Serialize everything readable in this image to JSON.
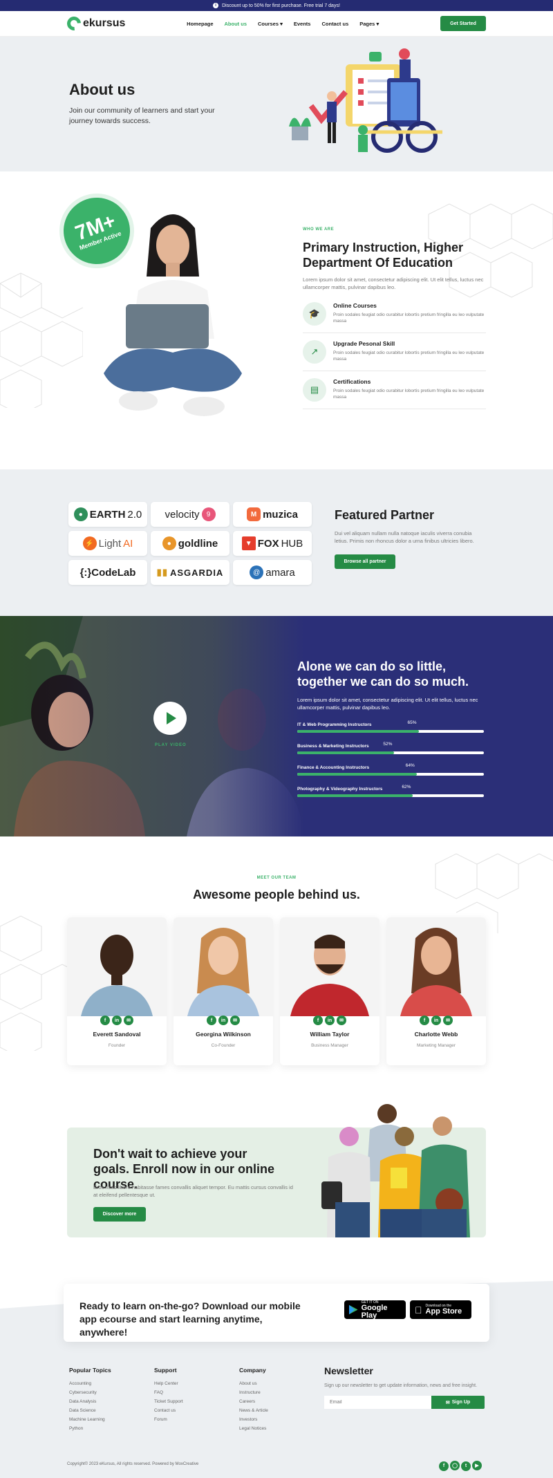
{
  "topbar": {
    "text": "Discount up to 50% for first purchase. Free trial 7 days!"
  },
  "nav": {
    "brand": "ekursus",
    "items": [
      "Homepage",
      "About us",
      "Courses",
      "Events",
      "Contact us",
      "Pages"
    ],
    "cta": "Get Started"
  },
  "hero": {
    "title": "About us",
    "subtitle": "Join our community of learners and start your journey towards success."
  },
  "about": {
    "badge_value": "7M+",
    "badge_label": "Member Active",
    "eyebrow": "WHO WE ARE",
    "title": "Primary Instruction, Higher Department Of Education",
    "text": "Lorem ipsum dolor sit amet, consectetur adipiscing elit. Ut elit tellus, luctus nec ullamcorper mattis, pulvinar dapibus leo.",
    "features": [
      {
        "title": "Online Courses",
        "text": "Proin sodales feugiat odio curabitur lobortis pretium fringilla eu leo vulputate massa",
        "icon": "graduation-cap-icon"
      },
      {
        "title": "Upgrade Pesonal Skill",
        "text": "Proin sodales feugiat odio curabitur lobortis pretium fringilla eu leo vulputate massa",
        "icon": "trend-up-icon"
      },
      {
        "title": "Certifications",
        "text": "Proin sodales feugiat odio curabitur lobortis pretium fringilla eu leo vulputate massa",
        "icon": "certificate-icon"
      }
    ]
  },
  "partners": {
    "title": "Featured Partner",
    "text": "Dui vel aliquam nullam nulla natoque iaculis viverra conubia letius. Primis non rhoncus dolor a urna finibus ultricies libero.",
    "button": "Browse all partner",
    "logos": [
      {
        "name": "EARTH",
        "suffix": "2.0",
        "color": "#2f8f5b"
      },
      {
        "name": "velocity",
        "suffix": "",
        "color": "#e8567a"
      },
      {
        "name": "muzica",
        "suffix": "",
        "color": "#f26a3d"
      },
      {
        "name": "Light",
        "suffix": "AI",
        "color": "#f26a21"
      },
      {
        "name": "goldline",
        "suffix": "",
        "color": "#e8952a"
      },
      {
        "name": "FOX",
        "suffix": "HUB",
        "color": "#e53d2c"
      },
      {
        "name": "{:}CodeLab",
        "suffix": "",
        "color": "#2f8f5b"
      },
      {
        "name": "ASGARDIA",
        "suffix": "",
        "color": "#d59a1e"
      },
      {
        "name": "amara",
        "suffix": "",
        "color": "#2b72b8"
      }
    ]
  },
  "stats": {
    "title": "Alone we can do so little, together we can do so much.",
    "text": "Lorem ipsum dolor sit amet, consectetur adipiscing elit. Ut elit tellus, luctus nec ullamcorper mattis, pulvinar dapibus leo.",
    "play_label": "PLAY VIDEO",
    "skills": [
      {
        "label": "IT & Web Programming Instructors",
        "percent": 65,
        "text": "65%"
      },
      {
        "label": "Business & Marketing Instructors",
        "percent": 52,
        "text": "52%"
      },
      {
        "label": "Finance & Accounting Instructors",
        "percent": 64,
        "text": "64%"
      },
      {
        "label": "Photography & Videography Instructors",
        "percent": 62,
        "text": "62%"
      }
    ]
  },
  "team": {
    "eyebrow": "MEET OUR TEAM",
    "title": "Awesome people behind us.",
    "members": [
      {
        "name": "Everett Sandoval",
        "role": "Founder",
        "bg": "#8fb0c9"
      },
      {
        "name": "Georgina Wilkinson",
        "role": "Co-Founder",
        "bg": "#a9c3de"
      },
      {
        "name": "William Taylor",
        "role": "Business Manager",
        "bg": "#c0272d"
      },
      {
        "name": "Charlotte Webb",
        "role": "Marketing Manager",
        "bg": "#d84d4a"
      }
    ]
  },
  "cta": {
    "title": "Don't wait to achieve your goals. Enroll now in our online course.",
    "text": "Eros risus libero habitasse fames convallis aliquet tempor. Eu mattis cursus convallis id at eleifend pellentesque ut.",
    "button": "Discover more"
  },
  "app": {
    "title": "Ready to learn on-the-go? Download our mobile app ecourse and start learning anytime, anywhere!",
    "google_small": "GET IT ON",
    "google": "Google Play",
    "apple_small": "Download on the",
    "apple": "App Store"
  },
  "footer": {
    "cols": [
      {
        "title": "Popular Topics",
        "items": [
          "Accounting",
          "Cybersecurity",
          "Data Analysis",
          "Data Science",
          "Machine Learning",
          "Python"
        ]
      },
      {
        "title": "Support",
        "items": [
          "Help Center",
          "FAQ",
          "Ticket Support",
          "Contact us",
          "Forum"
        ]
      },
      {
        "title": "Company",
        "items": [
          "About us",
          "Instructure",
          "Careers",
          "News & Article",
          "Investors",
          "Legal Notices"
        ]
      }
    ],
    "newsletter_title": "Newsletter",
    "newsletter_text": "Sign up our newsletter to get update information, news and free insight.",
    "email_placeholder": "Email",
    "signup": "Sign Up",
    "copyright": "Copyright© 2023 eKursus, All rights reserved. Powered by MoxCreative"
  }
}
